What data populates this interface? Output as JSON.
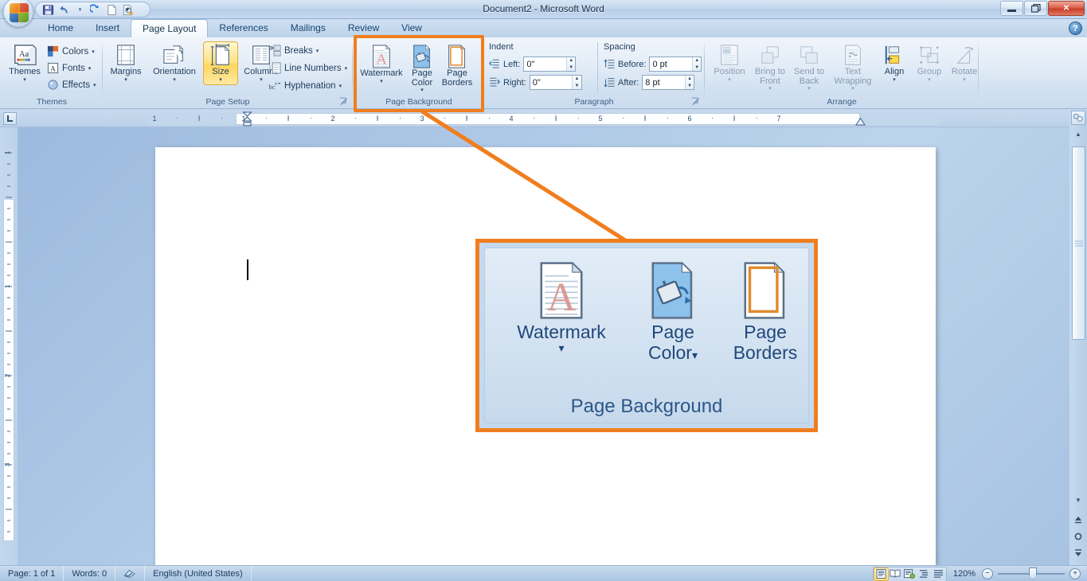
{
  "window": {
    "title": "Document2 - Microsoft Word",
    "controls": {
      "minimize": "minimize-icon",
      "restore": "restore-icon",
      "close": "✕"
    }
  },
  "quick_access": {
    "items": [
      {
        "name": "save-icon",
        "tooltip": "Save"
      },
      {
        "name": "undo-icon",
        "tooltip": "Undo"
      },
      {
        "name": "redo-icon",
        "tooltip": "Redo"
      },
      {
        "name": "new-icon",
        "tooltip": "New"
      },
      {
        "name": "print-preview-icon",
        "tooltip": "Print Preview"
      }
    ],
    "customize_caret": "▾"
  },
  "tabs": [
    {
      "label": "Home",
      "active": false
    },
    {
      "label": "Insert",
      "active": false
    },
    {
      "label": "Page Layout",
      "active": true
    },
    {
      "label": "References",
      "active": false
    },
    {
      "label": "Mailings",
      "active": false
    },
    {
      "label": "Review",
      "active": false
    },
    {
      "label": "View",
      "active": false
    }
  ],
  "help_button": "?",
  "ribbon": {
    "groups": [
      {
        "id": "themes",
        "title": "Themes",
        "big_buttons": [
          {
            "label": "Themes",
            "caret": "▾",
            "icon": "themes-icon"
          }
        ],
        "small_buttons": [
          {
            "label": "Colors",
            "caret": "▾",
            "icon": "theme-colors-icon"
          },
          {
            "label": "Fonts",
            "caret": "▾",
            "icon": "theme-fonts-icon"
          },
          {
            "label": "Effects",
            "caret": "▾",
            "icon": "theme-effects-icon"
          }
        ]
      },
      {
        "id": "page-setup",
        "title": "Page Setup",
        "big_buttons": [
          {
            "label": "Margins",
            "caret": "▾",
            "icon": "margins-icon"
          },
          {
            "label": "Orientation",
            "caret": "▾",
            "icon": "orientation-icon"
          },
          {
            "label": "Size",
            "caret": "▾",
            "icon": "size-icon",
            "selected": true
          },
          {
            "label": "Columns",
            "caret": "▾",
            "icon": "columns-icon"
          }
        ],
        "small_buttons": [
          {
            "label": "Breaks",
            "caret": "▾",
            "icon": "breaks-icon"
          },
          {
            "label": "Line Numbers",
            "caret": "▾",
            "icon": "line-numbers-icon"
          },
          {
            "label": "Hyphenation",
            "caret": "▾",
            "icon": "hyphenation-icon"
          }
        ],
        "has_dialog_launcher": true
      },
      {
        "id": "page-background",
        "title": "Page Background",
        "highlighted": true,
        "big_buttons": [
          {
            "label": "Watermark",
            "caret": "▾",
            "icon": "watermark-icon"
          },
          {
            "label": "Page Color",
            "caret": "▾",
            "icon": "page-color-icon"
          },
          {
            "label": "Page Borders",
            "caret": "",
            "icon": "page-borders-icon"
          }
        ]
      },
      {
        "id": "paragraph",
        "title": "Paragraph",
        "has_dialog_launcher": true,
        "subgroups": [
          {
            "heading": "Indent",
            "fields": [
              {
                "label": "Left:",
                "value": "0\"",
                "icon": "indent-left-icon"
              },
              {
                "label": "Right:",
                "value": "0\"",
                "icon": "indent-right-icon"
              }
            ]
          },
          {
            "heading": "Spacing",
            "fields": [
              {
                "label": "Before:",
                "value": "0 pt",
                "icon": "spacing-before-icon"
              },
              {
                "label": "After:",
                "value": "8 pt",
                "icon": "spacing-after-icon"
              }
            ]
          }
        ]
      },
      {
        "id": "arrange",
        "title": "Arrange",
        "big_buttons": [
          {
            "label": "Position",
            "caret": "▾",
            "icon": "position-icon",
            "disabled": true
          },
          {
            "label": "Bring to Front",
            "caret": "▾",
            "icon": "bring-to-front-icon",
            "disabled": true
          },
          {
            "label": "Send to Back",
            "caret": "▾",
            "icon": "send-to-back-icon",
            "disabled": true
          },
          {
            "label": "Text Wrapping",
            "caret": "▾",
            "icon": "text-wrapping-icon",
            "disabled": true
          },
          {
            "label": "Align",
            "caret": "▾",
            "icon": "align-icon"
          },
          {
            "label": "Group",
            "caret": "▾",
            "icon": "group-icon",
            "disabled": true
          },
          {
            "label": "Rotate",
            "caret": "▾",
            "icon": "rotate-icon",
            "disabled": true
          }
        ]
      }
    ]
  },
  "ruler": {
    "tab_selector": "L",
    "horizontal_numbers": [
      "1",
      "1",
      "2",
      "3",
      "4",
      "5",
      "6",
      "7"
    ],
    "vertical_numbers": [
      "1",
      "1",
      "2",
      "3"
    ]
  },
  "callout": {
    "title": "Page Background",
    "buttons": [
      {
        "label_line1": "Watermark",
        "label_line2": "",
        "caret": "▾",
        "icon": "watermark-icon"
      },
      {
        "label_line1": "Page",
        "label_line2": "Color",
        "caret": "▾",
        "icon": "page-color-icon"
      },
      {
        "label_line1": "Page",
        "label_line2": "Borders",
        "caret": "",
        "icon": "page-borders-icon"
      }
    ]
  },
  "annotation": {
    "highlight_color": "#f07e1e"
  },
  "status_bar": {
    "page": "Page: 1 of 1",
    "words": "Words: 0",
    "proofing_icon": "spelling-check-icon",
    "language": "English (United States)",
    "view_buttons": [
      {
        "name": "print-layout-view",
        "active": true
      },
      {
        "name": "full-screen-reading-view",
        "active": false
      },
      {
        "name": "web-layout-view",
        "active": false
      },
      {
        "name": "outline-view",
        "active": false
      },
      {
        "name": "draft-view",
        "active": false
      }
    ],
    "zoom_level": "120%",
    "zoom_out": "−",
    "zoom_in": "+"
  }
}
